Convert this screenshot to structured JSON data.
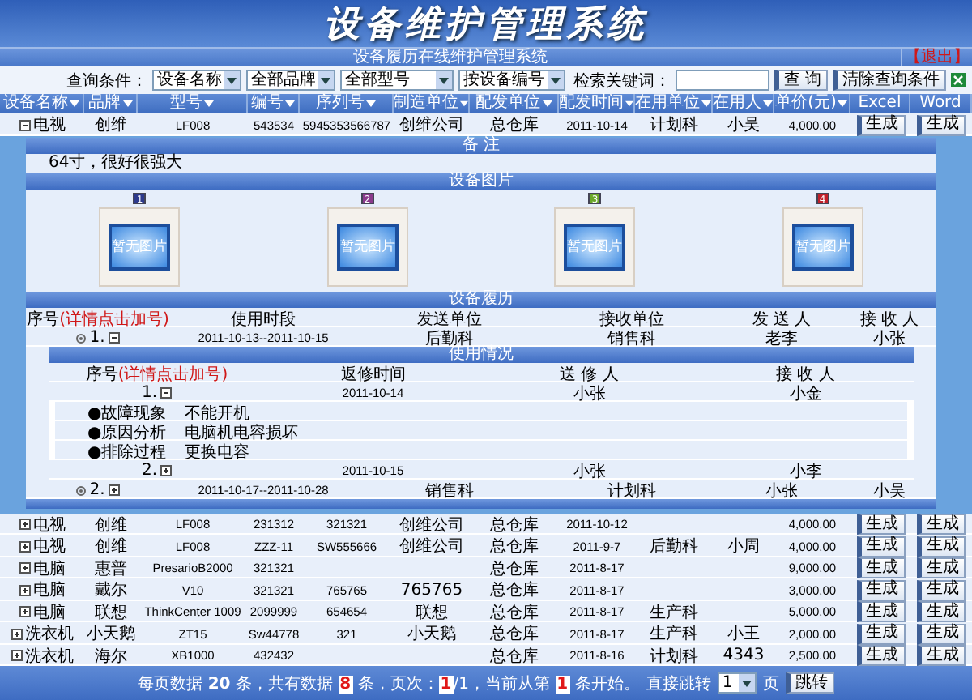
{
  "title": "设备维护管理系统",
  "nav": {
    "title": "设备履历在线维护管理系统",
    "logout": "【退出】"
  },
  "search": {
    "label": "查询条件：",
    "selects": [
      "设备名称",
      "全部品牌",
      "全部型号",
      "按设备编号"
    ],
    "keyword_label": "检索关键词：",
    "buttons": [
      "查 询",
      "清除查询条件"
    ]
  },
  "columns": [
    "设备名称",
    "品牌",
    "型号",
    "编号",
    "序列号",
    "制造单位",
    "配发单位",
    "配发时间",
    "在用单位",
    "在用人",
    "单价(元)",
    "Excel",
    "Word"
  ],
  "rows": [
    {
      "expanded": true,
      "cells": [
        "电视",
        "创维",
        "LF008",
        "543534",
        "5945353566787",
        "创维公司",
        "总仓库",
        "2011-10-14",
        "计划科",
        "小吴",
        "4,000.00"
      ],
      "actions": [
        "生成",
        "生成"
      ]
    },
    {
      "expanded": false,
      "cells": [
        "电视",
        "创维",
        "LF008",
        "231312",
        "321321",
        "创维公司",
        "总仓库",
        "2011-10-12",
        null,
        null,
        "4,000.00"
      ],
      "actions": [
        "生成",
        "生成"
      ]
    },
    {
      "expanded": false,
      "cells": [
        "电视",
        "创维",
        "LF008",
        "ZZZ-11",
        "SW555666",
        "创维公司",
        "总仓库",
        "2011-9-7",
        "后勤科",
        "小周",
        "4,000.00"
      ],
      "actions": [
        "生成",
        "生成"
      ]
    },
    {
      "expanded": false,
      "cells": [
        "电脑",
        "惠普",
        "PresarioB2000",
        "321321",
        null,
        null,
        "总仓库",
        "2011-8-17",
        null,
        null,
        "9,000.00"
      ],
      "actions": [
        "生成",
        "生成"
      ]
    },
    {
      "expanded": false,
      "cells": [
        "电脑",
        "戴尔",
        "V10",
        "321321",
        "765765",
        "765765",
        "总仓库",
        "2011-8-17",
        null,
        null,
        "3,000.00"
      ],
      "actions": [
        "生成",
        "生成"
      ]
    },
    {
      "expanded": false,
      "cells": [
        "电脑",
        "联想",
        "ThinkCenter 1009",
        "2099999",
        "654654",
        "联想",
        "总仓库",
        "2011-8-17",
        "生产科",
        null,
        "5,000.00"
      ],
      "actions": [
        "生成",
        "生成"
      ]
    },
    {
      "expanded": false,
      "cells": [
        "洗衣机",
        "小天鹅",
        "ZT15",
        "Sw44778",
        "321",
        "小天鹅",
        "总仓库",
        "2011-8-17",
        "生产科",
        "小王",
        "2,000.00"
      ],
      "actions": [
        "生成",
        "生成"
      ]
    },
    {
      "expanded": false,
      "cells": [
        "洗衣机",
        "海尔",
        "XB1000",
        "432432",
        null,
        null,
        "总仓库",
        "2011-8-16",
        "计划科",
        "4343",
        "2,500.00"
      ],
      "actions": [
        "生成",
        "生成"
      ]
    }
  ],
  "detail": {
    "note_title": "备 注",
    "note": "64寸，很好很强大",
    "photos_title": "设备图片",
    "photos": [
      {
        "badge": "1",
        "color": "#2e3a8c",
        "placeholder": "暂无图片"
      },
      {
        "badge": "2",
        "color": "#8a3a8c",
        "placeholder": "暂无图片"
      },
      {
        "badge": "3",
        "color": "#6aa82a",
        "placeholder": "暂无图片"
      },
      {
        "badge": "4",
        "color": "#c0202a",
        "placeholder": "暂无图片"
      }
    ],
    "history": {
      "title": "设备履历",
      "columns": [
        "序号",
        "使用时段",
        "发送单位",
        "接收单位",
        "发 送 人",
        "接 收 人"
      ],
      "hint": "(详情点击加号)",
      "records": [
        {
          "expanded": true,
          "seq": "1.",
          "cells": [
            "2011-10-13--2011-10-15",
            "后勤科",
            "销售科",
            "老李",
            "小张"
          ],
          "usage": {
            "title": "使用情况",
            "columns": [
              "序号",
              "返修时间",
              "送 修 人",
              "接 收 人"
            ],
            "hint": "(详情点击加号)",
            "entries": [
              {
                "expanded": true,
                "seq": "1.",
                "cells": [
                  "2011-10-14",
                  "小张",
                  "小金"
                ],
                "details": [
                  {
                    "label": "●故障现象",
                    "value": "不能开机"
                  },
                  {
                    "label": "●原因分析",
                    "value": "电脑机电容损坏"
                  },
                  {
                    "label": "●排除过程",
                    "value": "更换电容"
                  }
                ]
              },
              {
                "expanded": false,
                "seq": "2.",
                "cells": [
                  "2011-10-15",
                  "小张",
                  "小李"
                ]
              }
            ]
          }
        },
        {
          "expanded": false,
          "seq": "2.",
          "cells": [
            "2011-10-17--2011-10-28",
            "销售科",
            "计划科",
            "小张",
            "小吴"
          ]
        }
      ]
    }
  },
  "pagination": {
    "segments": [
      {
        "text": "每页数据 ",
        "kind": "plain"
      },
      {
        "text": "20",
        "kind": "bold"
      },
      {
        "text": " 条，共有数据 ",
        "kind": "plain"
      },
      {
        "text": "8",
        "kind": "red"
      },
      {
        "text": " 条，页次：",
        "kind": "plain"
      },
      {
        "text": "1",
        "kind": "red"
      },
      {
        "text": "/1，当前从第 ",
        "kind": "plain"
      },
      {
        "text": "1",
        "kind": "red"
      },
      {
        "text": " 条开始。",
        "kind": "plain"
      }
    ],
    "jump_label": "直接跳转",
    "page": "1",
    "page_unit": "页",
    "jump_button": "跳转"
  }
}
